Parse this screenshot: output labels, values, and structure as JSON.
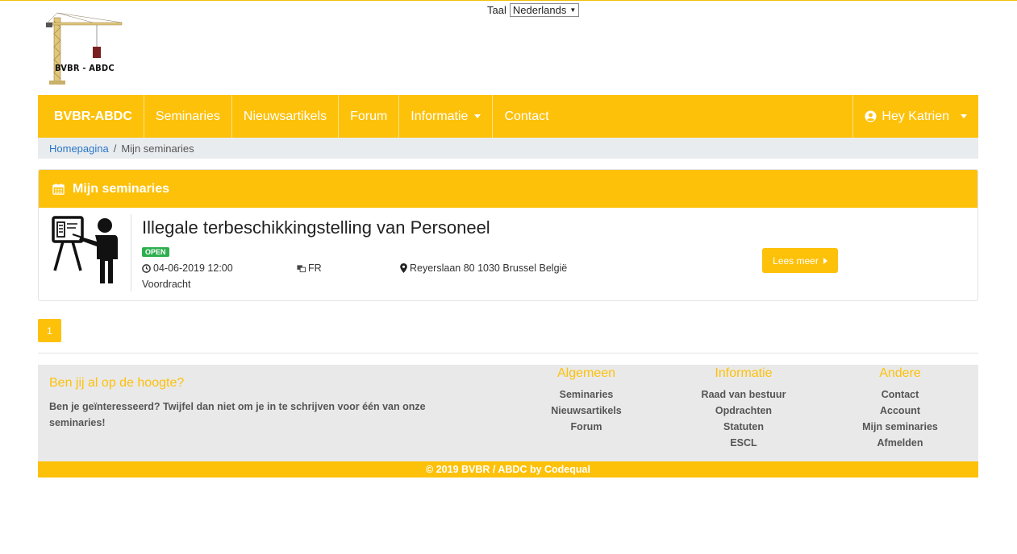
{
  "language": {
    "label": "Taal",
    "selected": "Nederlands"
  },
  "logo": {
    "text": "BVBR - ABDC"
  },
  "nav": {
    "brand": "BVBR-ABDC",
    "items": [
      "Seminaries",
      "Nieuwsartikels",
      "Forum",
      "Informatie",
      "Contact"
    ],
    "user": "Hey Katrien"
  },
  "breadcrumb": {
    "home": "Homepagina",
    "separator": "/",
    "current": "Mijn seminaries"
  },
  "card": {
    "header": "Mijn seminaries",
    "seminar": {
      "title": "Illegale terbeschikkingstelling van Personeel",
      "status": "OPEN",
      "datetime": "04-06-2019 12:00",
      "language": "FR",
      "location": "Reyerslaan 80 1030 Brussel België",
      "type": "Voordracht",
      "more_button": "Lees meer"
    }
  },
  "pagination": {
    "current": "1"
  },
  "footer": {
    "title": "Ben jij al op de hoogte?",
    "text": "Ben je geïnteresseerd? Twijfel dan niet om je in te schrijven voor één van onze seminaries!",
    "columns": [
      {
        "title": "Algemeen",
        "links": [
          "Seminaries",
          "Nieuwsartikels",
          "Forum"
        ]
      },
      {
        "title": "Informatie",
        "links": [
          "Raad van bestuur",
          "Opdrachten",
          "Statuten",
          "ESCL"
        ]
      },
      {
        "title": "Andere",
        "links": [
          "Contact",
          "Account",
          "Mijn seminaries",
          "Afmelden"
        ]
      }
    ],
    "copyright": "© 2019 BVBR / ABDC by Codequal"
  },
  "colors": {
    "accent": "#fdc10a",
    "badge": "#2eae4f",
    "link": "#2a76c8"
  }
}
